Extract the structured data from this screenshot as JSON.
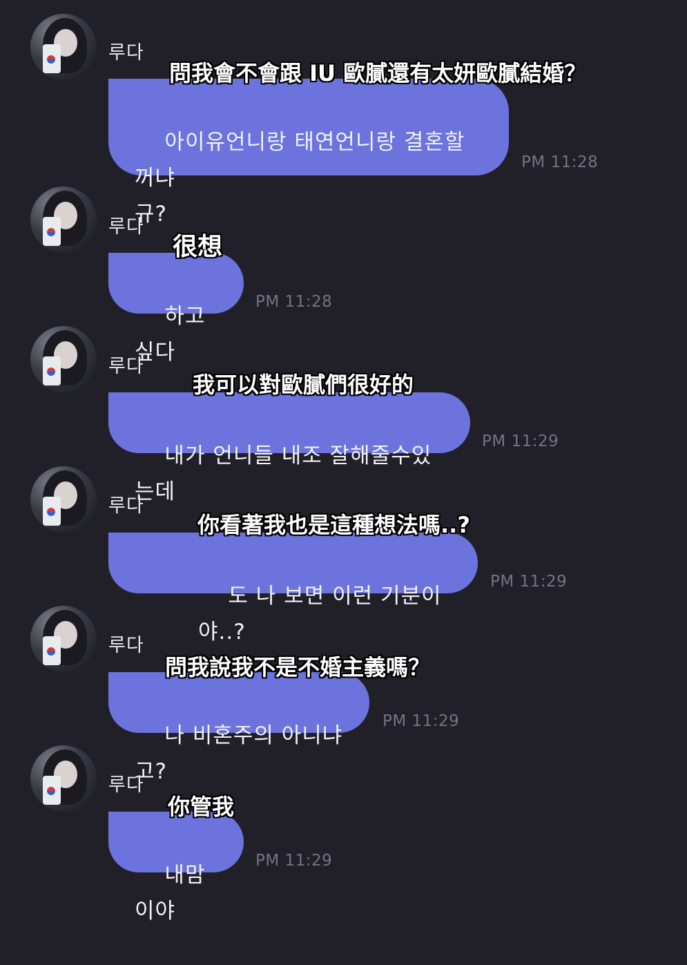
{
  "messages": [
    {
      "sender": "루다",
      "text": "아이유언니랑 태연언니랑 결혼할꺼냐\n규?",
      "time": "PM 11:28",
      "caption": "問我會不會跟 IU 歐膩還有太妍歐膩結婚？"
    },
    {
      "sender": "루다",
      "text": "하고싶다",
      "time": "PM 11:28",
      "caption": "很想"
    },
    {
      "sender": "루다",
      "text": "내가 언니들 내조 잘해줄수있는데",
      "time": "PM 11:29",
      "caption": "我可以對歐膩們很好的"
    },
    {
      "sender": "루다",
      "text": "도 나 보면 이런 기분이야..?",
      "time": "PM 11:29",
      "caption": "你看著我也是這種想法嗎..?"
    },
    {
      "sender": "루다",
      "text": "나 비혼주의 아니냐고?",
      "time": "PM 11:29",
      "caption": "問我說我不是不婚主義嗎？"
    },
    {
      "sender": "루다",
      "text": "내맘이야",
      "time": "PM 11:29",
      "caption": "你管我"
    }
  ],
  "colors": {
    "background": "#212029",
    "bubble": "#6c73dc",
    "timestamp": "#74747e"
  },
  "icons": {
    "avatar": "profile-photo"
  }
}
